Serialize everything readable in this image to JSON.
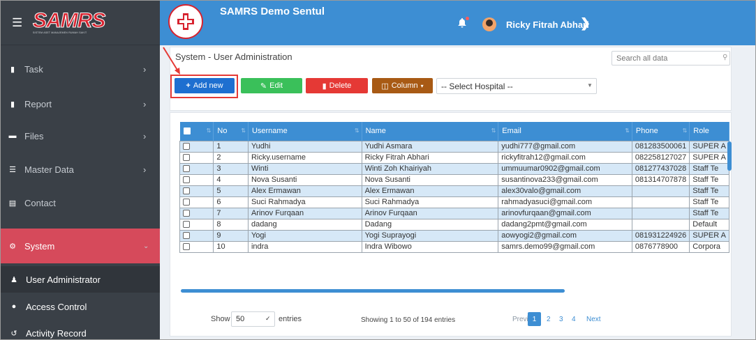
{
  "sidebar": {
    "logo_text": "SAMRS",
    "logo_subtitle": "SISTEM ASET MANAJEMEN RUMAH SAKIT",
    "items": [
      {
        "label": "Task",
        "icon": "briefcase-icon"
      },
      {
        "label": "Report",
        "icon": "briefcase-icon"
      },
      {
        "label": "Files",
        "icon": "folder-icon"
      },
      {
        "label": "Master Data",
        "icon": "database-icon"
      },
      {
        "label": "Contact",
        "icon": "address-card-icon"
      },
      {
        "label": "System",
        "icon": "cogs-icon"
      },
      {
        "label": "User Administrator",
        "icon": "users-icon"
      },
      {
        "label": "Access Control",
        "icon": "toggle-icon"
      },
      {
        "label": "Activity Record",
        "icon": "history-icon"
      }
    ]
  },
  "header": {
    "title": "SAMRS Demo Sentul",
    "user_name": "Ricky Fitrah Abhari"
  },
  "main": {
    "page_title": "System - User Administration",
    "search_placeholder": "Search all data",
    "buttons": {
      "add": "Add new",
      "edit": "Edit",
      "delete": "Delete",
      "column": "Column"
    },
    "hospital_select": "-- Select Hospital --"
  },
  "table": {
    "columns": [
      "No",
      "Username",
      "Name",
      "Email",
      "Phone",
      "Role"
    ],
    "rows": [
      [
        "1",
        "Yudhi",
        "Yudhi Asmara",
        "yudhi777@gmail.com",
        "081283500061",
        "SUPER A"
      ],
      [
        "2",
        "Ricky.username",
        "Ricky Fitrah Abhari",
        "rickyfitrah12@gmail.com",
        "082258127027",
        "SUPER A"
      ],
      [
        "3",
        "Winti",
        "Winti Zoh Khairiyah",
        "ummuumar0902@gmail.com",
        "081277437028",
        "Staff Te"
      ],
      [
        "4",
        "Nova Susanti",
        "Nova Susanti",
        "susantinova233@gmail.com",
        "081314707878",
        "Staff Te"
      ],
      [
        "5",
        "Alex Ermawan",
        "Alex Ermawan",
        "alex30valo@gmail.com",
        "",
        "Staff Te"
      ],
      [
        "6",
        "Suci Rahmadya",
        "Suci Rahmadya",
        "rahmadyasuci@gmail.com",
        "",
        "Staff Te"
      ],
      [
        "7",
        "Arinov Furqaan",
        "Arinov Furqaan",
        "arinovfurqaan@gmail.com",
        "",
        "Staff Te"
      ],
      [
        "8",
        "dadang",
        "Dadang",
        "dadang2pmt@gmail.com",
        "",
        "Default"
      ],
      [
        "9",
        "Yogi",
        "Yogi Suprayogi",
        "aowyogi2@gmail.com",
        "081931224926",
        "SUPER A"
      ],
      [
        "10",
        "indra",
        "Indra Wibowo",
        "samrs.demo99@gmail.com",
        "0876778900",
        "Corpora"
      ]
    ]
  },
  "footer": {
    "show_label": "Show",
    "page_size": "50",
    "entries_label": "entries",
    "info": "Showing 1 to 50 of 194 entries",
    "previous": "Previous",
    "pages": [
      "1",
      "2",
      "3",
      "4"
    ],
    "next": "Next"
  }
}
